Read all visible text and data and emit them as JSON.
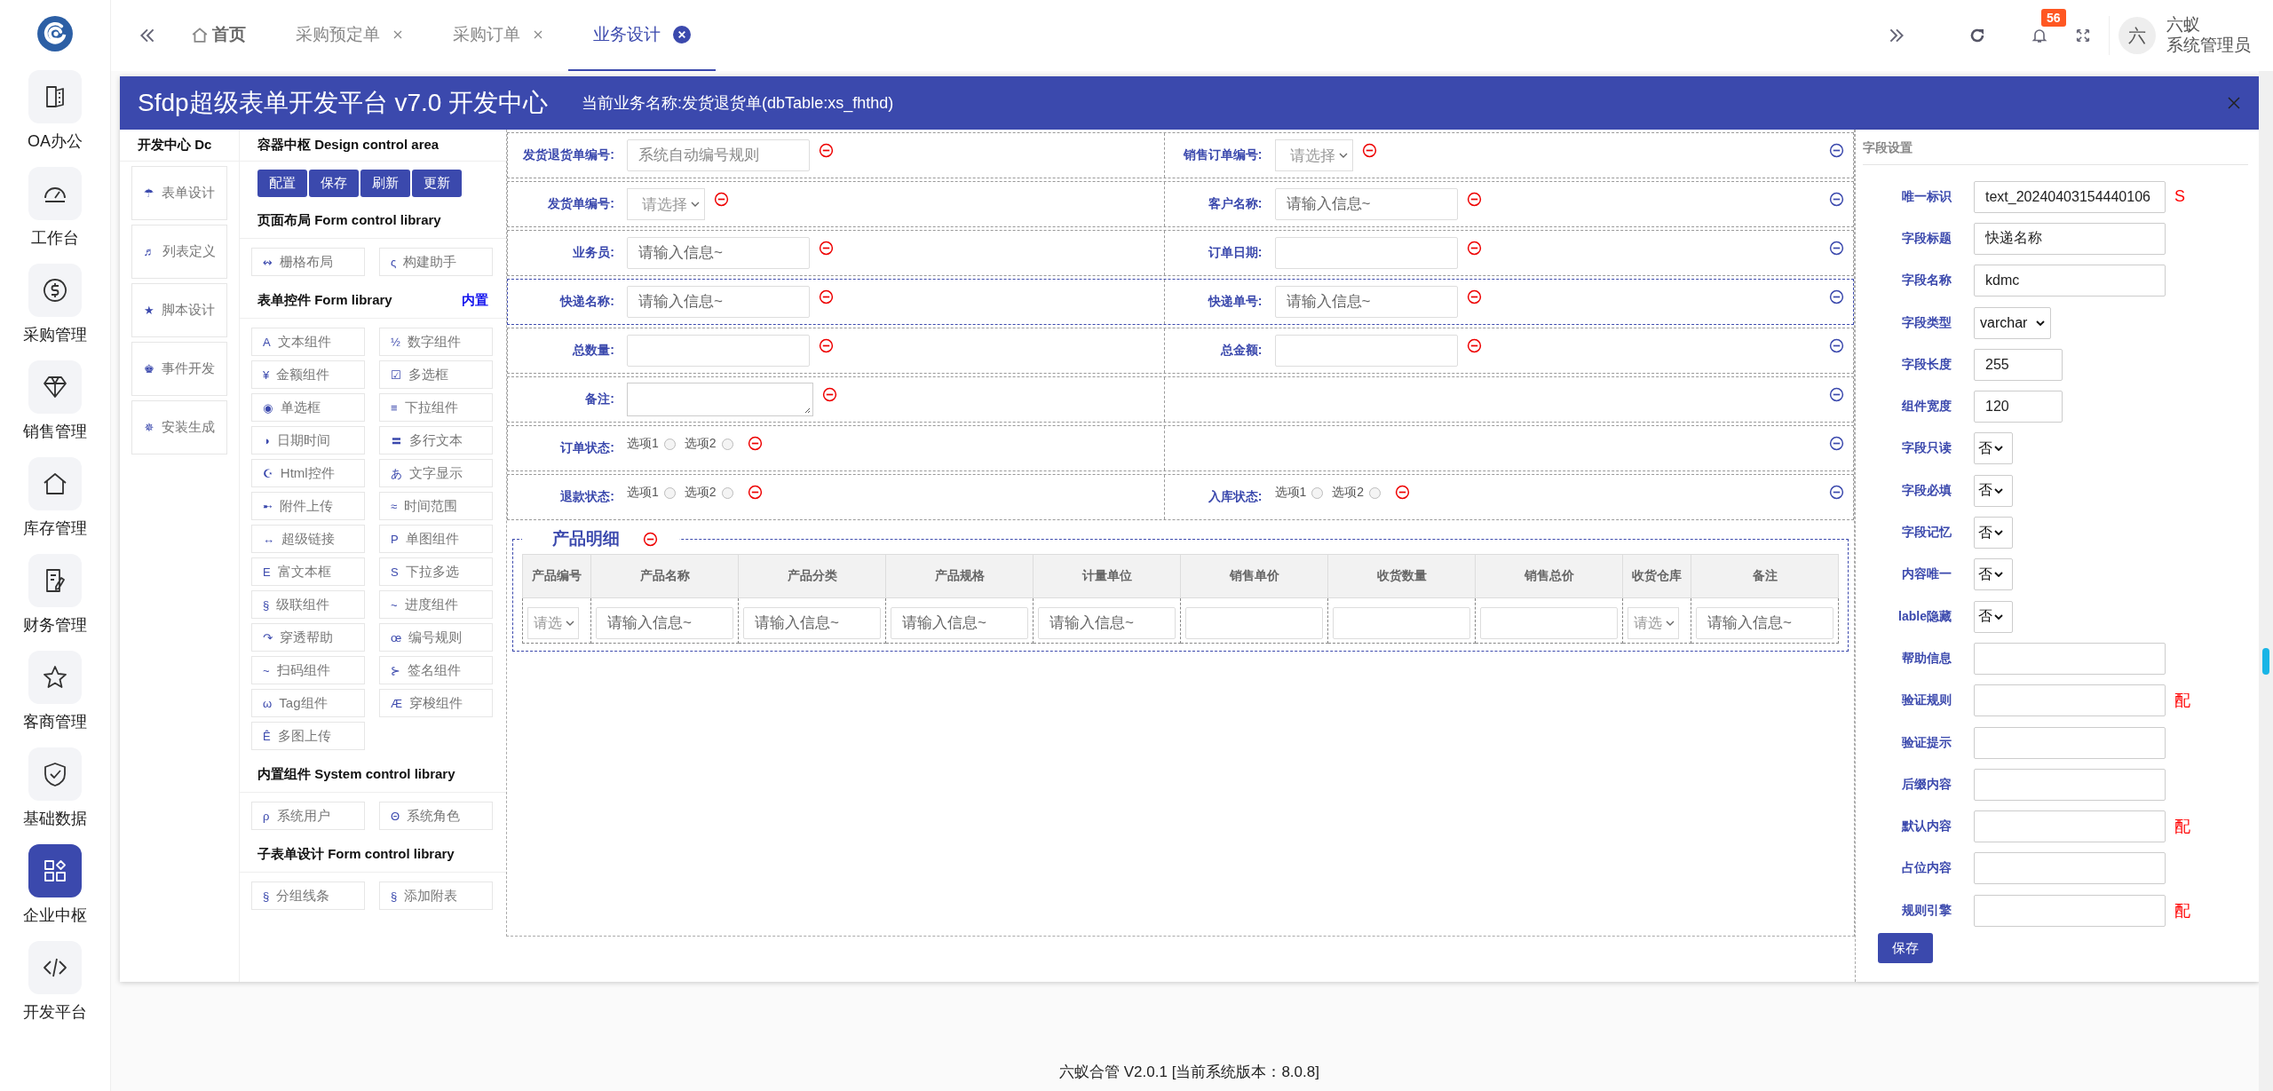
{
  "tabs": [
    {
      "label": "首页",
      "kind": "home",
      "selected": false
    },
    {
      "label": "采购预定单",
      "kind": "closable",
      "selected": false
    },
    {
      "label": "采购订单",
      "kind": "closable",
      "selected": false
    },
    {
      "label": "业务设计",
      "kind": "closable",
      "selected": true
    }
  ],
  "notifications": {
    "badge": "56"
  },
  "user": {
    "avatar": "六",
    "name": "六蚁",
    "role": "系统管理员"
  },
  "nav": [
    {
      "label": "OA办公",
      "selected": false
    },
    {
      "label": "工作台",
      "selected": false
    },
    {
      "label": "采购管理",
      "selected": false
    },
    {
      "label": "销售管理",
      "selected": false
    },
    {
      "label": "库存管理",
      "selected": false
    },
    {
      "label": "财务管理",
      "selected": false
    },
    {
      "label": "客商管理",
      "selected": false
    },
    {
      "label": "基础数据",
      "selected": false
    },
    {
      "label": "企业中枢",
      "selected": true
    },
    {
      "label": "开发平台",
      "selected": false
    }
  ],
  "dialog": {
    "title": "Sfdp超级表单开发平台 v7.0 开发中心",
    "subtitle": "当前业务名称:发货退货单(dbTable:xs_fhthd)"
  },
  "dev_center": {
    "title": "开发中心 Dc",
    "items": [
      {
        "icon": "☂",
        "label": "表单设计"
      },
      {
        "icon": "♬",
        "label": "列表定义"
      },
      {
        "icon": "★",
        "label": "脚本设计"
      },
      {
        "icon": "♚",
        "label": "事件开发"
      },
      {
        "icon": "✵",
        "label": "安装生成"
      }
    ]
  },
  "control_area": {
    "title": "容器中枢 Design control area",
    "buttons": [
      "配置",
      "保存",
      "刷新",
      "更新"
    ],
    "sections": [
      {
        "title": "页面布局 Form control library",
        "items": [
          {
            "icon": "↭",
            "label": "栅格布局"
          },
          {
            "icon": "ς",
            "label": "构建助手"
          }
        ]
      },
      {
        "title": "表单控件 Form library",
        "link": "内置",
        "items": [
          {
            "icon": "A",
            "label": "文本组件"
          },
          {
            "icon": "½",
            "label": "数字组件"
          },
          {
            "icon": "¥",
            "label": "金额组件"
          },
          {
            "icon": "☑",
            "label": "多选框"
          },
          {
            "icon": "◉",
            "label": "单选框"
          },
          {
            "icon": "≡",
            "label": "下拉组件"
          },
          {
            "icon": "◑",
            "label": "日期时间"
          },
          {
            "icon": "〓",
            "label": "多行文本"
          },
          {
            "icon": "☪",
            "label": "Html控件"
          },
          {
            "icon": "あ",
            "label": "文字显示"
          },
          {
            "icon": "➸",
            "label": "附件上传"
          },
          {
            "icon": "≈",
            "label": "时间范围"
          },
          {
            "icon": "↔",
            "label": "超级链接"
          },
          {
            "icon": "P",
            "label": "单图组件"
          },
          {
            "icon": "E",
            "label": "富文本框"
          },
          {
            "icon": "S",
            "label": "下拉多选"
          },
          {
            "icon": "§",
            "label": "级联组件"
          },
          {
            "icon": "~",
            "label": "进度组件"
          },
          {
            "icon": "↷",
            "label": "穿透帮助"
          },
          {
            "icon": "œ",
            "label": "编号规则"
          },
          {
            "icon": "~",
            "label": "扫码组件"
          },
          {
            "icon": "⊱",
            "label": "签名组件"
          },
          {
            "icon": "ω",
            "label": "Tag组件"
          },
          {
            "icon": "Æ",
            "label": "穿梭组件"
          },
          {
            "icon": "Ê",
            "label": "多图上传"
          }
        ]
      },
      {
        "title": "内置组件 System control library",
        "items": [
          {
            "icon": "ρ",
            "label": "系统用户"
          },
          {
            "icon": "Θ",
            "label": "系统角色"
          }
        ]
      },
      {
        "title": "子表单设计 Form control library",
        "items": [
          {
            "icon": "§",
            "label": "分组线条"
          },
          {
            "icon": "§",
            "label": "添加附表"
          }
        ]
      }
    ]
  },
  "form": {
    "rows": [
      {
        "selected": false,
        "cells": [
          {
            "label": "发货退货单编号:",
            "kind": "input",
            "placeholder": "系统自动编号规则"
          },
          {
            "label": "销售订单编号:",
            "kind": "select",
            "placeholder": "请选择"
          }
        ]
      },
      {
        "selected": false,
        "cells": [
          {
            "label": "发货单编号:",
            "kind": "select",
            "placeholder": "请选择"
          },
          {
            "label": "客户名称:",
            "kind": "input",
            "placeholder": "请输入信息~"
          }
        ]
      },
      {
        "selected": false,
        "cells": [
          {
            "label": "业务员:",
            "kind": "input",
            "placeholder": "请输入信息~"
          },
          {
            "label": "订单日期:",
            "kind": "input"
          }
        ]
      },
      {
        "selected": true,
        "cells": [
          {
            "label": "快递名称:",
            "kind": "input",
            "placeholder": "请输入信息~"
          },
          {
            "label": "快递单号:",
            "kind": "input",
            "placeholder": "请输入信息~"
          }
        ]
      },
      {
        "selected": false,
        "cells": [
          {
            "label": "总数量:",
            "kind": "input"
          },
          {
            "label": "总金额:",
            "kind": "input"
          }
        ]
      },
      {
        "selected": false,
        "cells": [
          {
            "label": "备注:",
            "kind": "textarea"
          }
        ]
      },
      {
        "selected": false,
        "cells": [
          {
            "label": "订单状态:",
            "kind": "radio",
            "options": [
              {
                "label": "选项1",
                "checked": false
              },
              {
                "label": "选项2",
                "checked": false
              }
            ]
          }
        ]
      },
      {
        "selected": false,
        "cells": [
          {
            "label": "退款状态:",
            "kind": "radio",
            "options": [
              {
                "label": "选项1",
                "checked": false
              },
              {
                "label": "选项2",
                "checked": false
              }
            ]
          },
          {
            "label": "入库状态:",
            "kind": "radio",
            "options": [
              {
                "label": "选项1",
                "checked": false
              },
              {
                "label": "选项2",
                "checked": false
              }
            ]
          }
        ]
      }
    ],
    "detail": {
      "title": "产品明细",
      "columns": [
        "产品编号",
        "产品名称",
        "产品分类",
        "产品规格",
        "计量单位",
        "销售单价",
        "收货数量",
        "销售总价",
        "收货仓库",
        "备注"
      ],
      "cells": [
        {
          "kind": "select",
          "placeholder": "请选"
        },
        {
          "kind": "input",
          "placeholder": "请输入信息~"
        },
        {
          "kind": "input",
          "placeholder": "请输入信息~"
        },
        {
          "kind": "input",
          "placeholder": "请输入信息~"
        },
        {
          "kind": "input",
          "placeholder": "请输入信息~"
        },
        {
          "kind": "input"
        },
        {
          "kind": "input"
        },
        {
          "kind": "input"
        },
        {
          "kind": "select",
          "placeholder": "请选"
        },
        {
          "kind": "input",
          "placeholder": "请输入信息~"
        }
      ]
    }
  },
  "settings": {
    "title": "字段设置",
    "fields": [
      {
        "label": "唯一标识",
        "kind": "text",
        "value": "text_20240403154440106",
        "suffix": "S"
      },
      {
        "label": "字段标题",
        "kind": "text",
        "value": "快递名称"
      },
      {
        "label": "字段名称",
        "kind": "text",
        "value": "kdmc"
      },
      {
        "label": "字段类型",
        "kind": "select",
        "value": "varchar"
      },
      {
        "label": "字段长度",
        "kind": "number",
        "value": "255"
      },
      {
        "label": "组件宽度",
        "kind": "number",
        "value": "120"
      },
      {
        "label": "字段只读",
        "kind": "choice",
        "value": "否"
      },
      {
        "label": "字段必填",
        "kind": "choice",
        "value": "否"
      },
      {
        "label": "字段记忆",
        "kind": "choice",
        "value": "否"
      },
      {
        "label": "内容唯一",
        "kind": "choice",
        "value": "否"
      },
      {
        "label": "lable隐藏",
        "kind": "choice",
        "value": "否"
      },
      {
        "label": "帮助信息",
        "kind": "text"
      },
      {
        "label": "验证规则",
        "kind": "text",
        "suffix": "配"
      },
      {
        "label": "验证提示",
        "kind": "text"
      },
      {
        "label": "后缀内容",
        "kind": "text"
      },
      {
        "label": "默认内容",
        "kind": "text",
        "suffix": "配"
      },
      {
        "label": "占位内容",
        "kind": "text"
      },
      {
        "label": "规则引擎",
        "kind": "text",
        "suffix": "配"
      }
    ],
    "save": "保存"
  },
  "footer": "六蚁合管 V2.0.1 [当前系统版本：8.0.8]"
}
